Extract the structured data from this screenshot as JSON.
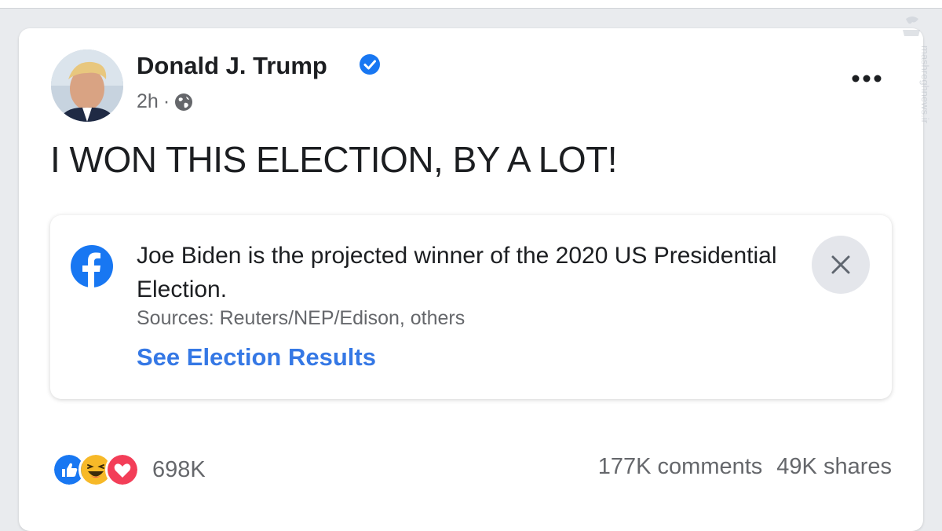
{
  "post": {
    "author": "Donald J. Trump",
    "time": "2h",
    "separator": "·",
    "text": "I WON THIS ELECTION, BY A LOT!"
  },
  "info_label": {
    "message": "Joe Biden is the projected winner of the 2020 US Presidential Election.",
    "sources": "Sources: Reuters/NEP/Edison, others",
    "link": "See Election Results"
  },
  "footer": {
    "reaction_count": "698K",
    "comments": "177K comments",
    "shares": "49K shares"
  },
  "watermark": {
    "text": "mashreghnews.ir"
  },
  "icons": {
    "verified": "verified-badge-icon",
    "globe": "globe-icon",
    "more": "more-options-icon",
    "facebook": "facebook-icon",
    "close": "close-icon",
    "reactions": [
      "like-icon",
      "haha-icon",
      "love-icon"
    ]
  },
  "colors": {
    "brand_blue": "#1877f2",
    "link_blue": "#3578e5",
    "text_primary": "#1c1e21",
    "text_secondary": "#65676b",
    "love_red": "#f33e58",
    "haha_yellow": "#f7b928"
  }
}
